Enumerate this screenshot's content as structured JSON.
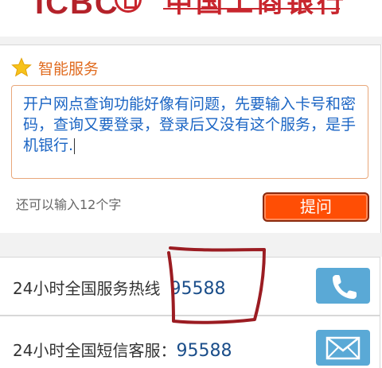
{
  "header": {
    "logo_text": "ICBC",
    "bank_name": "中国工商银行"
  },
  "smart_service": {
    "title": "智能服务",
    "question_text": "开户网点查询功能好像有问题，先要输入卡号和密码，查询又要登录，登录后又没有这个服务，是手机银行",
    "question_end": ".",
    "remaining_text": "还可以输入12个字",
    "submit_label": "提问"
  },
  "services": [
    {
      "label": "24小时全国服务热线",
      "number": "95588",
      "icon": "phone-icon"
    },
    {
      "label": "24小时全国短信客服：",
      "number": "95588",
      "icon": "envelope-icon"
    }
  ],
  "colors": {
    "accent_orange": "#ff4e05",
    "icon_button_blue": "#5aa9d6",
    "text_blue": "#1b65c4",
    "brand_red": "#c8262e"
  }
}
